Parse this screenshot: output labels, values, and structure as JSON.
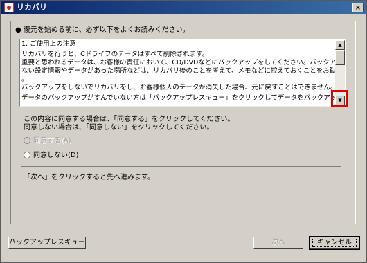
{
  "window": {
    "title": "リカバリ",
    "close_label": "×"
  },
  "intro_text": "● 復元を始める前に、必ず以下をよくお読みください。",
  "notice": {
    "lines": [
      "1. ご使用上の注意",
      "リカバリを行うと、Cドライブのデータはすべて削除されます。",
      "重要と思われるデータは、お客様の責任において、CD/DVDなどにバックアップをしてください。バックアップでき",
      "ない設定情報やデータがあった場所などは、リカバリ後のことを考えて、メモなどに控えておくことをお勧めします",
      "。",
      "バックアップをしないでリカバリをし、お客様個人のデータが消失した場合、元に戻すことはできません。",
      "データのバックアップがすんでいない方は「バックアップレスキュー」をクリックしてデータをバックアップしてくださ"
    ],
    "scroll_up_icon": "▲",
    "scroll_down_icon": "▼"
  },
  "agree_instructions": [
    "この内容に同意する場合は、「同意する」をクリックしてください。",
    "同意しない場合は、「同意しない」をクリックしてください。"
  ],
  "options": {
    "agree_label": "同意する(A)",
    "disagree_label": "同意しない(D)",
    "selected": "disagree"
  },
  "next_hint": "「次へ」をクリックすると先へ進みます。",
  "buttons": {
    "backup_rescue": "バックアップレスキュー",
    "next": "次へ",
    "cancel": "キャンセル"
  }
}
